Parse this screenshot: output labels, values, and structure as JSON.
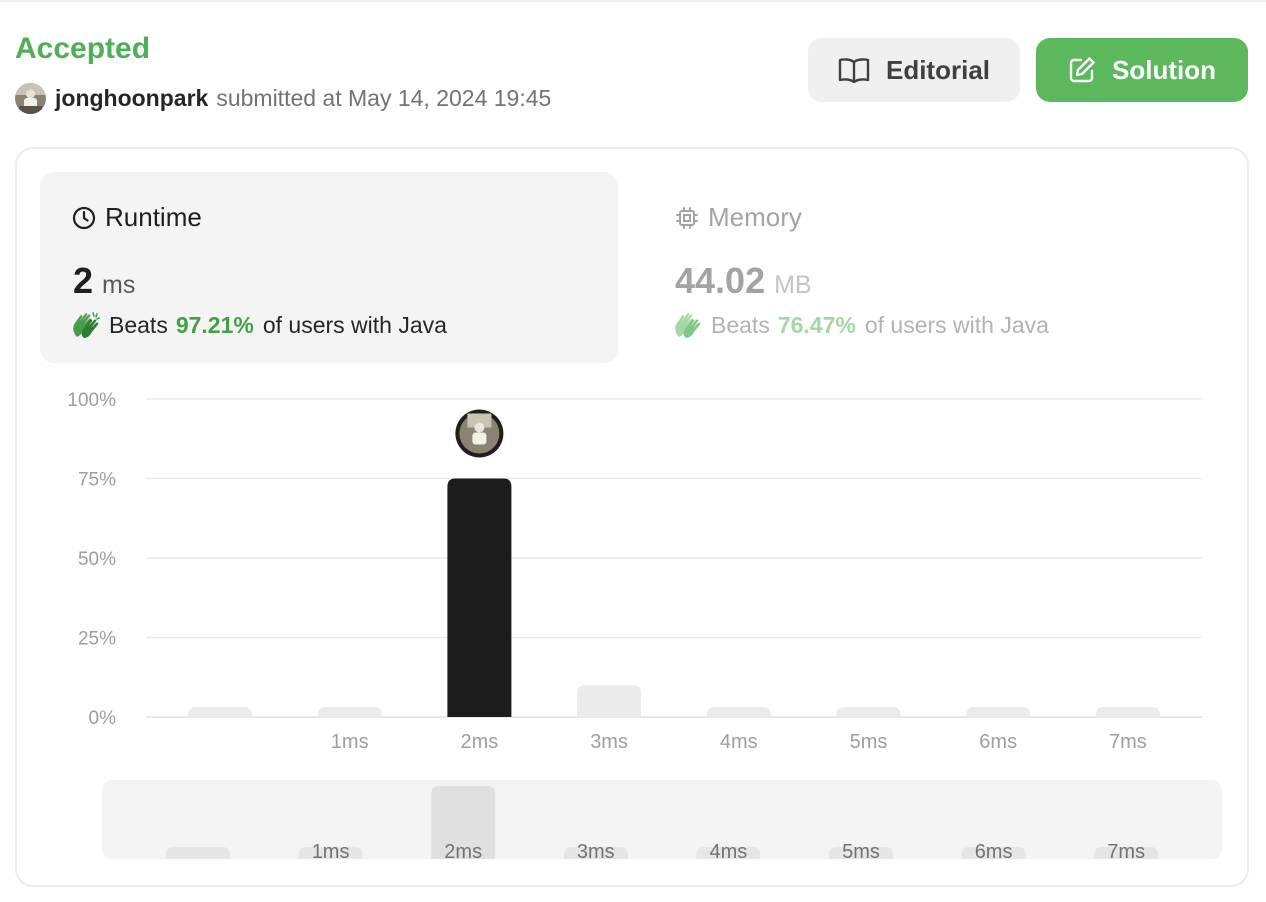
{
  "header": {
    "status": "Accepted",
    "username": "jonghoonpark",
    "submitted_text": "submitted at May 14, 2024 19:45"
  },
  "buttons": {
    "editorial_label": "Editorial",
    "solution_label": "Solution"
  },
  "runtime": {
    "label": "Runtime",
    "value": "2",
    "unit": "ms",
    "beats_label": "Beats",
    "beats_pct": "97.21%",
    "beats_suffix": "of users with Java"
  },
  "memory": {
    "label": "Memory",
    "value": "44.02",
    "unit": "MB",
    "beats_label": "Beats",
    "beats_pct": "76.47%",
    "beats_suffix": "of users with Java"
  },
  "colors": {
    "accepted": "#4fae5a",
    "solution_button": "#5cb85c",
    "selected_bar": "#1c1c1c",
    "bar": "#ebebeb",
    "beats_pct": "#43a047"
  },
  "icons": {
    "editorial": "book-open-icon",
    "solution": "edit-icon",
    "runtime": "clock-icon",
    "memory": "cpu-chip-icon",
    "beats": "clapping-hands-icon"
  },
  "chart_data": {
    "type": "bar",
    "categories": [
      "",
      "1ms",
      "2ms",
      "3ms",
      "4ms",
      "5ms",
      "6ms",
      "7ms"
    ],
    "series": [
      {
        "values": [
          1,
          1,
          75,
          10,
          1,
          1,
          1,
          1
        ]
      }
    ],
    "highlight_index": 2,
    "ylim": [
      0,
      100
    ],
    "yticks": [
      "100%",
      "75%",
      "50%",
      "25%",
      "0%"
    ],
    "grid": true,
    "brush_categories": [
      "",
      "1ms",
      "2ms",
      "3ms",
      "4ms",
      "5ms",
      "6ms",
      "7ms"
    ],
    "brush_values": [
      2,
      2,
      12,
      2,
      2,
      2,
      2,
      2
    ]
  }
}
